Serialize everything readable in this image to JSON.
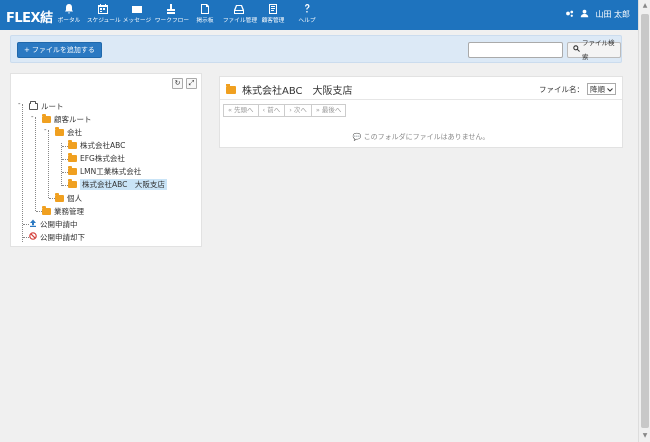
{
  "header": {
    "brand": "FLEX結",
    "nav": [
      {
        "label": "ポータル",
        "icon": "bell-icon"
      },
      {
        "label": "スケジュール",
        "icon": "calendar-icon"
      },
      {
        "label": "メッセージ",
        "icon": "envelope-icon"
      },
      {
        "label": "ワークフロー",
        "icon": "stamp-icon"
      },
      {
        "label": "掲示板",
        "icon": "board-icon"
      },
      {
        "label": "ファイル管理",
        "icon": "drive-icon"
      },
      {
        "label": "顧客管理",
        "icon": "customer-icon"
      },
      {
        "label": "ヘルプ",
        "icon": "question-icon"
      }
    ],
    "user_name": "山田 太郎"
  },
  "toolbar": {
    "add_file_label": "ファイルを追加する",
    "search_placeholder": "",
    "search_button_label": "ファイル検索"
  },
  "tree": {
    "root": "ルート",
    "customer_root": "顧客ルート",
    "company": "会社",
    "companies": [
      "株式会社ABC",
      "EFG株式会社",
      "LMN工業株式会社",
      "株式会社ABC　大阪支店"
    ],
    "individual": "個人",
    "business": "業務管理",
    "publish_pending": "公開申請中",
    "publish_rejected": "公開申請却下"
  },
  "content": {
    "folder_title": "株式会社ABC　大阪支店",
    "sort_label": "ファイル名：",
    "sort_value": "降順",
    "pager": [
      "« 先頭へ",
      "‹ 前へ",
      "› 次へ",
      "» 最後へ"
    ],
    "empty_message": "このフォルダにファイルはありません。"
  },
  "colors": {
    "header_bg": "#1e73be",
    "folder": "#f0a020",
    "selected": "#c9e4f7"
  }
}
